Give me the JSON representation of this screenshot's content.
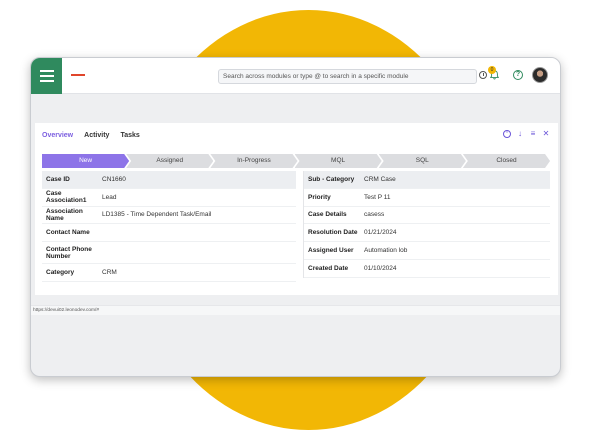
{
  "search": {
    "placeholder": "Search across modules or type @ to search in a specific module"
  },
  "notifications": {
    "count": "0"
  },
  "tabs": [
    {
      "label": "Overview",
      "active": true
    },
    {
      "label": "Activity",
      "active": false
    },
    {
      "label": "Tasks",
      "active": false
    }
  ],
  "stages": [
    {
      "label": "New",
      "active": true
    },
    {
      "label": "Assigned",
      "active": false
    },
    {
      "label": "In-Progress",
      "active": false
    },
    {
      "label": "MQL",
      "active": false
    },
    {
      "label": "SQL",
      "active": false
    },
    {
      "label": "Closed",
      "active": false
    }
  ],
  "fields_left": [
    {
      "label": "Case ID",
      "value": "CN1660"
    },
    {
      "label": "Case Association1",
      "value": "Lead"
    },
    {
      "label": "Association Name",
      "value": "LD1385 - Time Dependent Task/Email"
    },
    {
      "label": "Contact Name",
      "value": ""
    },
    {
      "label": "Contact Phone Number",
      "value": ""
    },
    {
      "label": "Category",
      "value": "CRM"
    }
  ],
  "fields_right": [
    {
      "label": "Sub - Category",
      "value": "CRM Case"
    },
    {
      "label": "Priority",
      "value": "Test P 11"
    },
    {
      "label": "Case Details",
      "value": "casess"
    },
    {
      "label": "Resolution Date",
      "value": "01/21/2024"
    },
    {
      "label": "Assigned User",
      "value": "Automation lob"
    },
    {
      "label": "Created Date",
      "value": "01/10/2024"
    }
  ],
  "status_url": "https://devui02.leonodev.com/#",
  "colors": {
    "accent": "#8d74e8",
    "brand": "#2f8a5e",
    "yellow": "#f2b705"
  }
}
